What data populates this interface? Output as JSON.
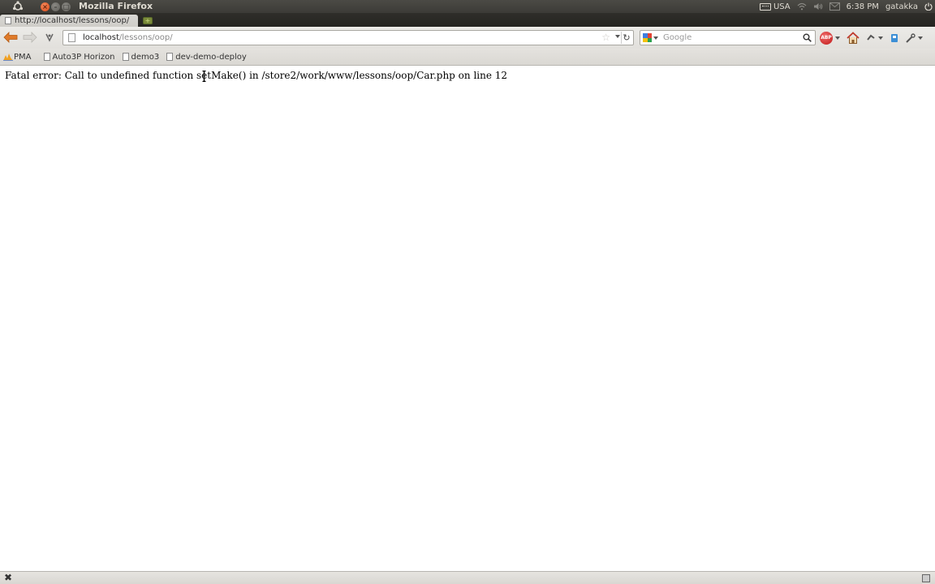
{
  "system_panel": {
    "window_title": "Mozilla Firefox",
    "keyboard_layout": "USA",
    "time": "6:38 PM",
    "user": "gatakka"
  },
  "tabs": [
    {
      "label": "http://localhost/lessons/oop/",
      "active": true
    }
  ],
  "urlbar": {
    "host": "localhost",
    "path": "/lessons/oop/"
  },
  "search": {
    "placeholder": "Google",
    "value": ""
  },
  "bookmarks": [
    {
      "label": "PMA",
      "icon": "pma-icon"
    },
    {
      "label": "Auto3P Horizon",
      "icon": "page-icon"
    },
    {
      "label": "demo3",
      "icon": "page-icon"
    },
    {
      "label": "dev-demo-deploy",
      "icon": "page-icon"
    }
  ],
  "page": {
    "error_message": "Fatal error: Call to undefined function setMake() in /store2/work/www/lessons/oop/Car.php on line 12"
  },
  "icons": {
    "back": "back-arrow-icon",
    "forward": "forward-arrow-icon",
    "reload": "reload-icon",
    "star": "bookmark-star-icon",
    "adblock": "adblock-plus-icon",
    "home": "home-icon"
  },
  "colors": {
    "panel_bg": "#3c3b37",
    "close_button": "#e5561f",
    "back_arrow": "#e07b2a",
    "adblock": "#c01818"
  }
}
